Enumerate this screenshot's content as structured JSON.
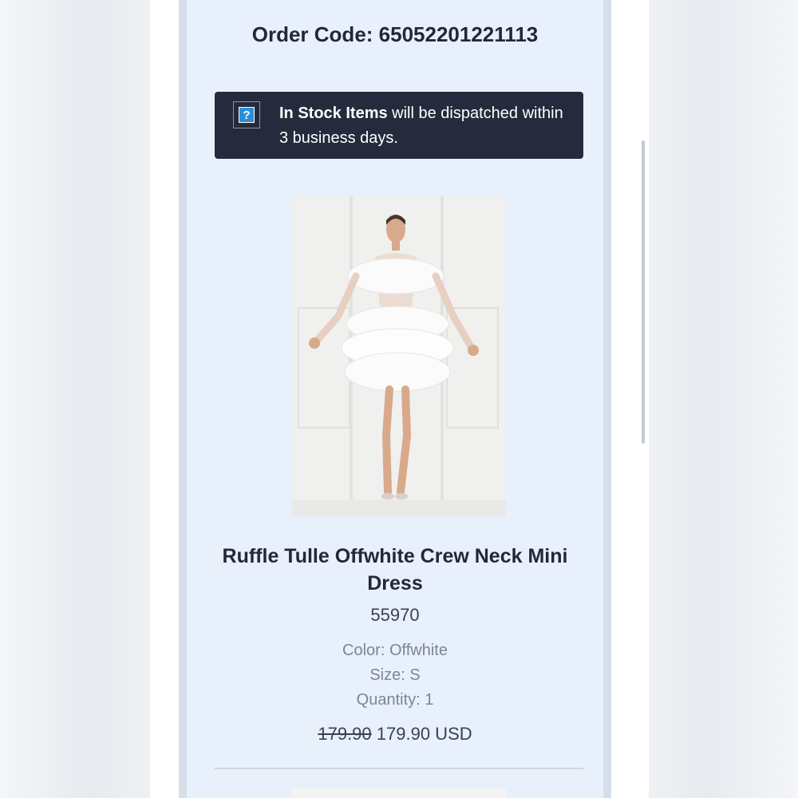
{
  "order": {
    "label": "Order Code:",
    "code": "65052201221113"
  },
  "notice": {
    "strong": "In Stock Items",
    "rest": " will be dispatched within 3 business days.",
    "icon": "question-icon",
    "icon_glyph": "?"
  },
  "product": {
    "title": "Ruffle Tulle Offwhite Crew Neck Mini Dress",
    "sku": "55970",
    "color": "Color: Offwhite",
    "size": "Size: S",
    "quantity": "Quantity: 1",
    "old_price": "179.90",
    "price": "179.90 USD"
  },
  "colors": {
    "panel_bg": "#e8f0fb",
    "notice_bg": "#252b3c",
    "icon_blue": "#2a8fd6",
    "heading_text": "#22283a",
    "muted_text": "#7d8594"
  }
}
